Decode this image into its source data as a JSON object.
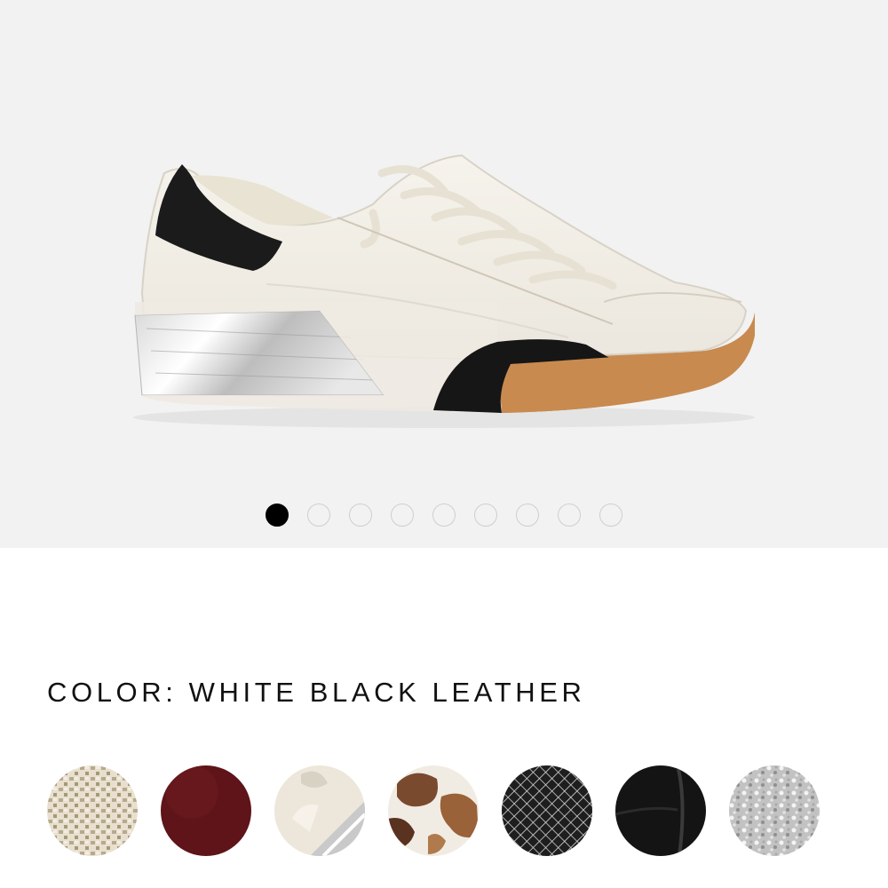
{
  "gallery": {
    "background": "#f2f2f2",
    "slide_count": 9,
    "active_index": 0,
    "image_alt": "white-black-leather-sneaker-icon"
  },
  "product": {
    "color_heading": "COLOR: WHITE BLACK LEATHER"
  },
  "swatches": [
    {
      "icon": "woven-raffia-swatch-icon",
      "color": "#d8cdb8"
    },
    {
      "icon": "burgundy-leather-swatch-icon",
      "color": "#5e1418"
    },
    {
      "icon": "white-silver-swatch-icon",
      "color": "#e9e4d6"
    },
    {
      "icon": "cow-print-swatch-icon",
      "color": "#8b5a3c"
    },
    {
      "icon": "black-white-mesh-swatch-icon",
      "color": "#2a2a2a"
    },
    {
      "icon": "black-leather-swatch-icon",
      "color": "#141414"
    },
    {
      "icon": "silver-glitter-swatch-icon",
      "color": "#c4c4c4"
    }
  ]
}
